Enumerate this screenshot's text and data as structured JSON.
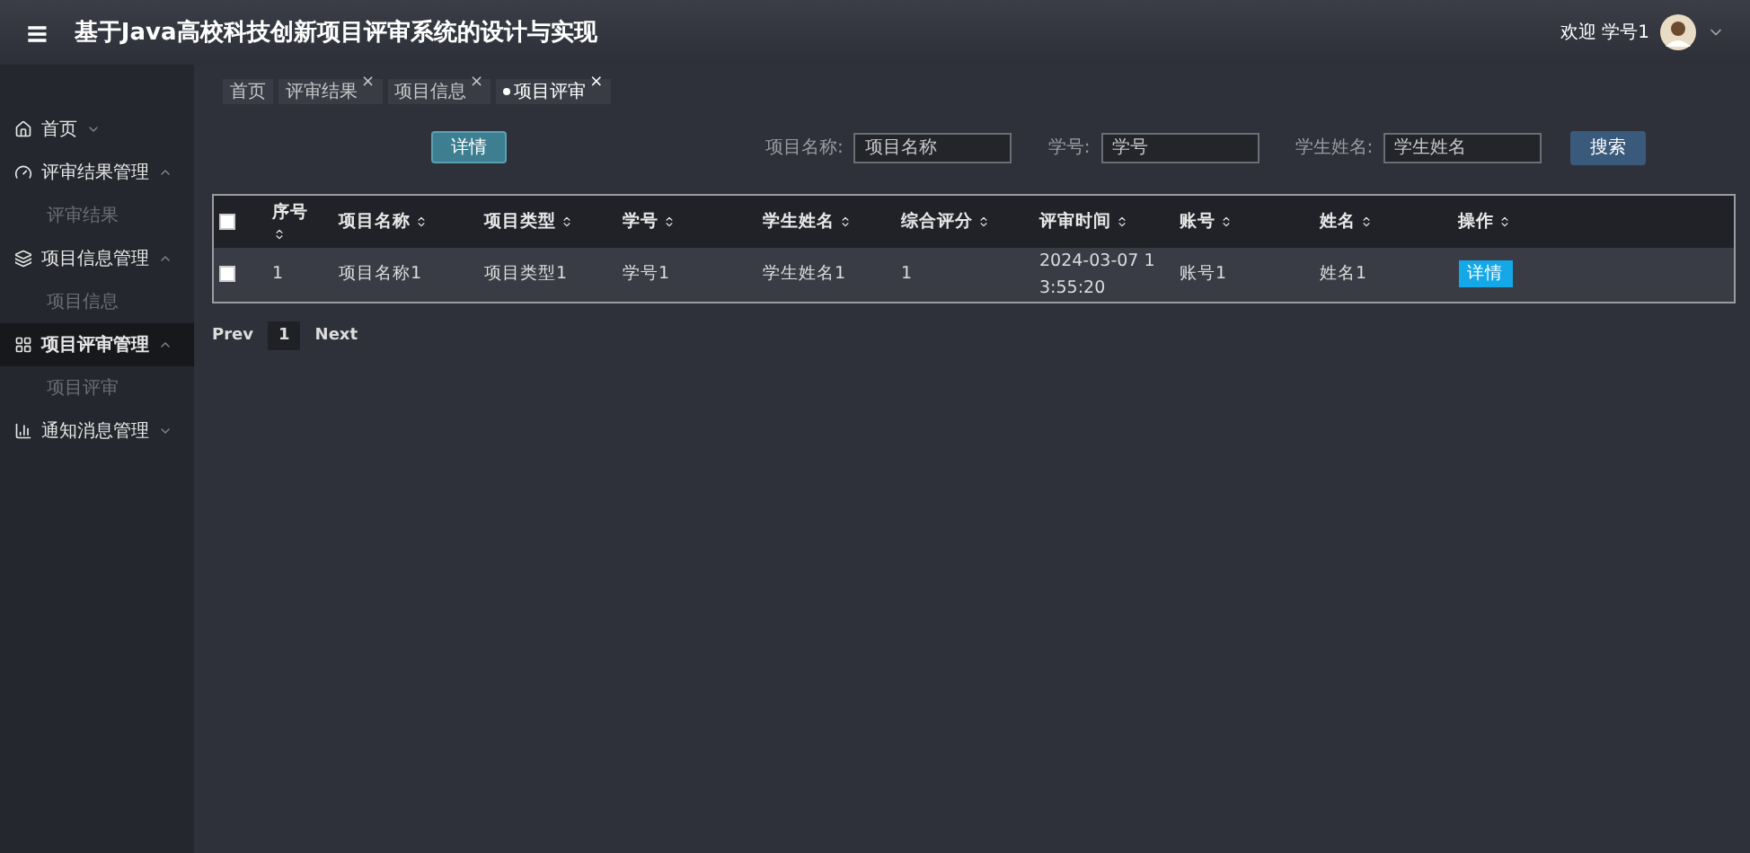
{
  "header": {
    "menu_icon": "≡",
    "title": "基于Java高校科技创新项目评审系统的设计与实现",
    "greeting": "欢迎 学号1"
  },
  "sidebar": {
    "items": [
      {
        "label": "首页",
        "expanded": false,
        "selected": false
      },
      {
        "label": "评审结果管理",
        "expanded": true,
        "selected": false,
        "children": [
          {
            "label": "评审结果"
          }
        ]
      },
      {
        "label": "项目信息管理",
        "expanded": true,
        "selected": false,
        "children": [
          {
            "label": "项目信息"
          }
        ]
      },
      {
        "label": "项目评审管理",
        "expanded": true,
        "selected": true,
        "children": [
          {
            "label": "项目评审"
          }
        ]
      },
      {
        "label": "通知消息管理",
        "expanded": false,
        "selected": false
      }
    ]
  },
  "tabs": [
    {
      "label": "首页",
      "selected": false
    },
    {
      "label": "评审结果",
      "selected": false,
      "close": "×"
    },
    {
      "label": "项目信息",
      "selected": false,
      "close": "×"
    },
    {
      "label": "项目评审",
      "selected": true,
      "close": "×"
    }
  ],
  "detail_button": "详情",
  "search": {
    "fields": [
      {
        "label": "项目名称:",
        "placeholder": "项目名称"
      },
      {
        "label": "学号:",
        "placeholder": "学号"
      },
      {
        "label": "学生姓名:",
        "placeholder": "学生姓名"
      }
    ],
    "button": "搜索"
  },
  "table": {
    "columns": [
      "序号",
      "项目名称",
      "项目类型",
      "学号",
      "学生姓名",
      "综合评分",
      "评审时间",
      "账号",
      "姓名",
      "操作"
    ],
    "rows": [
      {
        "checked": false,
        "cells": [
          "1",
          "项目名称1",
          "项目类型1",
          "学号1",
          "学生姓名1",
          "1",
          "2024-03-07 13:55:20",
          "账号1",
          "姓名1"
        ],
        "action": "详情"
      }
    ],
    "all_checked": false
  },
  "pagination": {
    "prev": "Prev",
    "pages": [
      {
        "label": "1",
        "selected": true
      }
    ],
    "next": "Next"
  }
}
